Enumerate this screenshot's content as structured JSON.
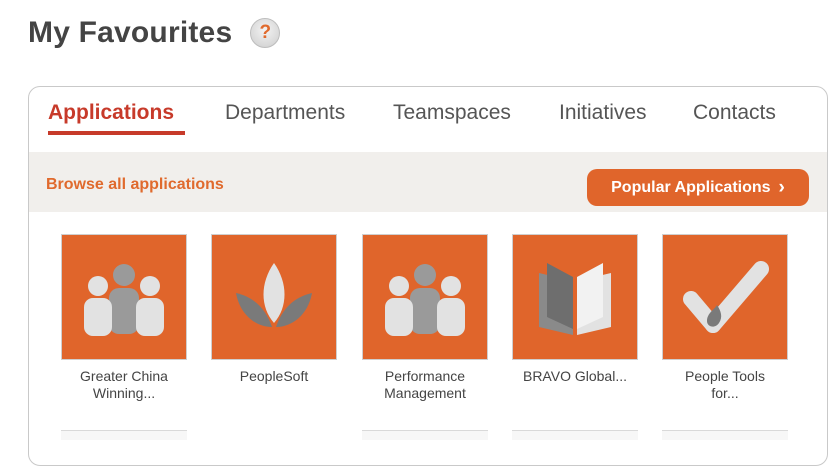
{
  "header": {
    "title": "My Favourites",
    "help_label": "?"
  },
  "tabs": [
    {
      "label": "Applications",
      "active": true
    },
    {
      "label": "Departments",
      "active": false
    },
    {
      "label": "Teamspaces",
      "active": false
    },
    {
      "label": "Initiatives",
      "active": false
    },
    {
      "label": "Contacts",
      "active": false
    }
  ],
  "toolbar": {
    "browse_label": "Browse all applications",
    "popular_label": "Popular Applications",
    "popular_chevron": "›"
  },
  "apps": [
    {
      "label_line1": "Greater China",
      "label_line2": "Winning...",
      "icon": "group-icon"
    },
    {
      "label_line1": "PeopleSoft",
      "label_line2": "",
      "icon": "lotus-icon"
    },
    {
      "label_line1": "Performance",
      "label_line2": "Management",
      "icon": "group-icon"
    },
    {
      "label_line1": "BRAVO Global...",
      "label_line2": "",
      "icon": "book-icon"
    },
    {
      "label_line1": "People Tools",
      "label_line2": "for...",
      "icon": "checkmark-icon"
    }
  ],
  "colors": {
    "accent": "#e0652b",
    "active_tab": "#c73a2a",
    "toolbar_bg": "#f1efec"
  }
}
